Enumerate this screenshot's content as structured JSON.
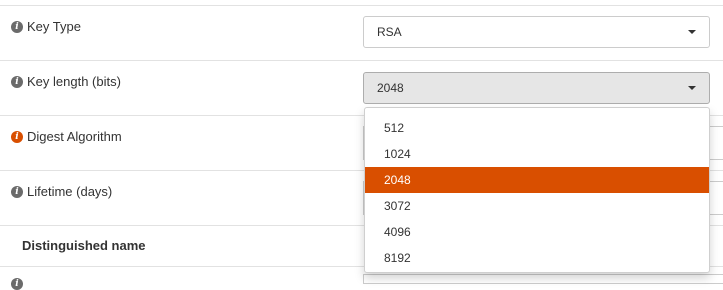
{
  "form": {
    "key_type": {
      "label": "Key Type",
      "value": "RSA"
    },
    "key_length": {
      "label": "Key length (bits)",
      "value": "2048",
      "options": [
        "512",
        "1024",
        "2048",
        "3072",
        "4096",
        "8192"
      ],
      "selected_index": 2
    },
    "digest": {
      "label": "Digest Algorithm"
    },
    "lifetime": {
      "label": "Lifetime (days)"
    },
    "section": {
      "title": "Distinguished name"
    }
  },
  "icons": {
    "info": "info-circle-icon",
    "caret": "caret-down-icon"
  },
  "colors": {
    "accent": "#d94f00",
    "info_icon": "#6b6b6b",
    "border": "#cccccc",
    "row_divider": "#e2e2e2"
  }
}
